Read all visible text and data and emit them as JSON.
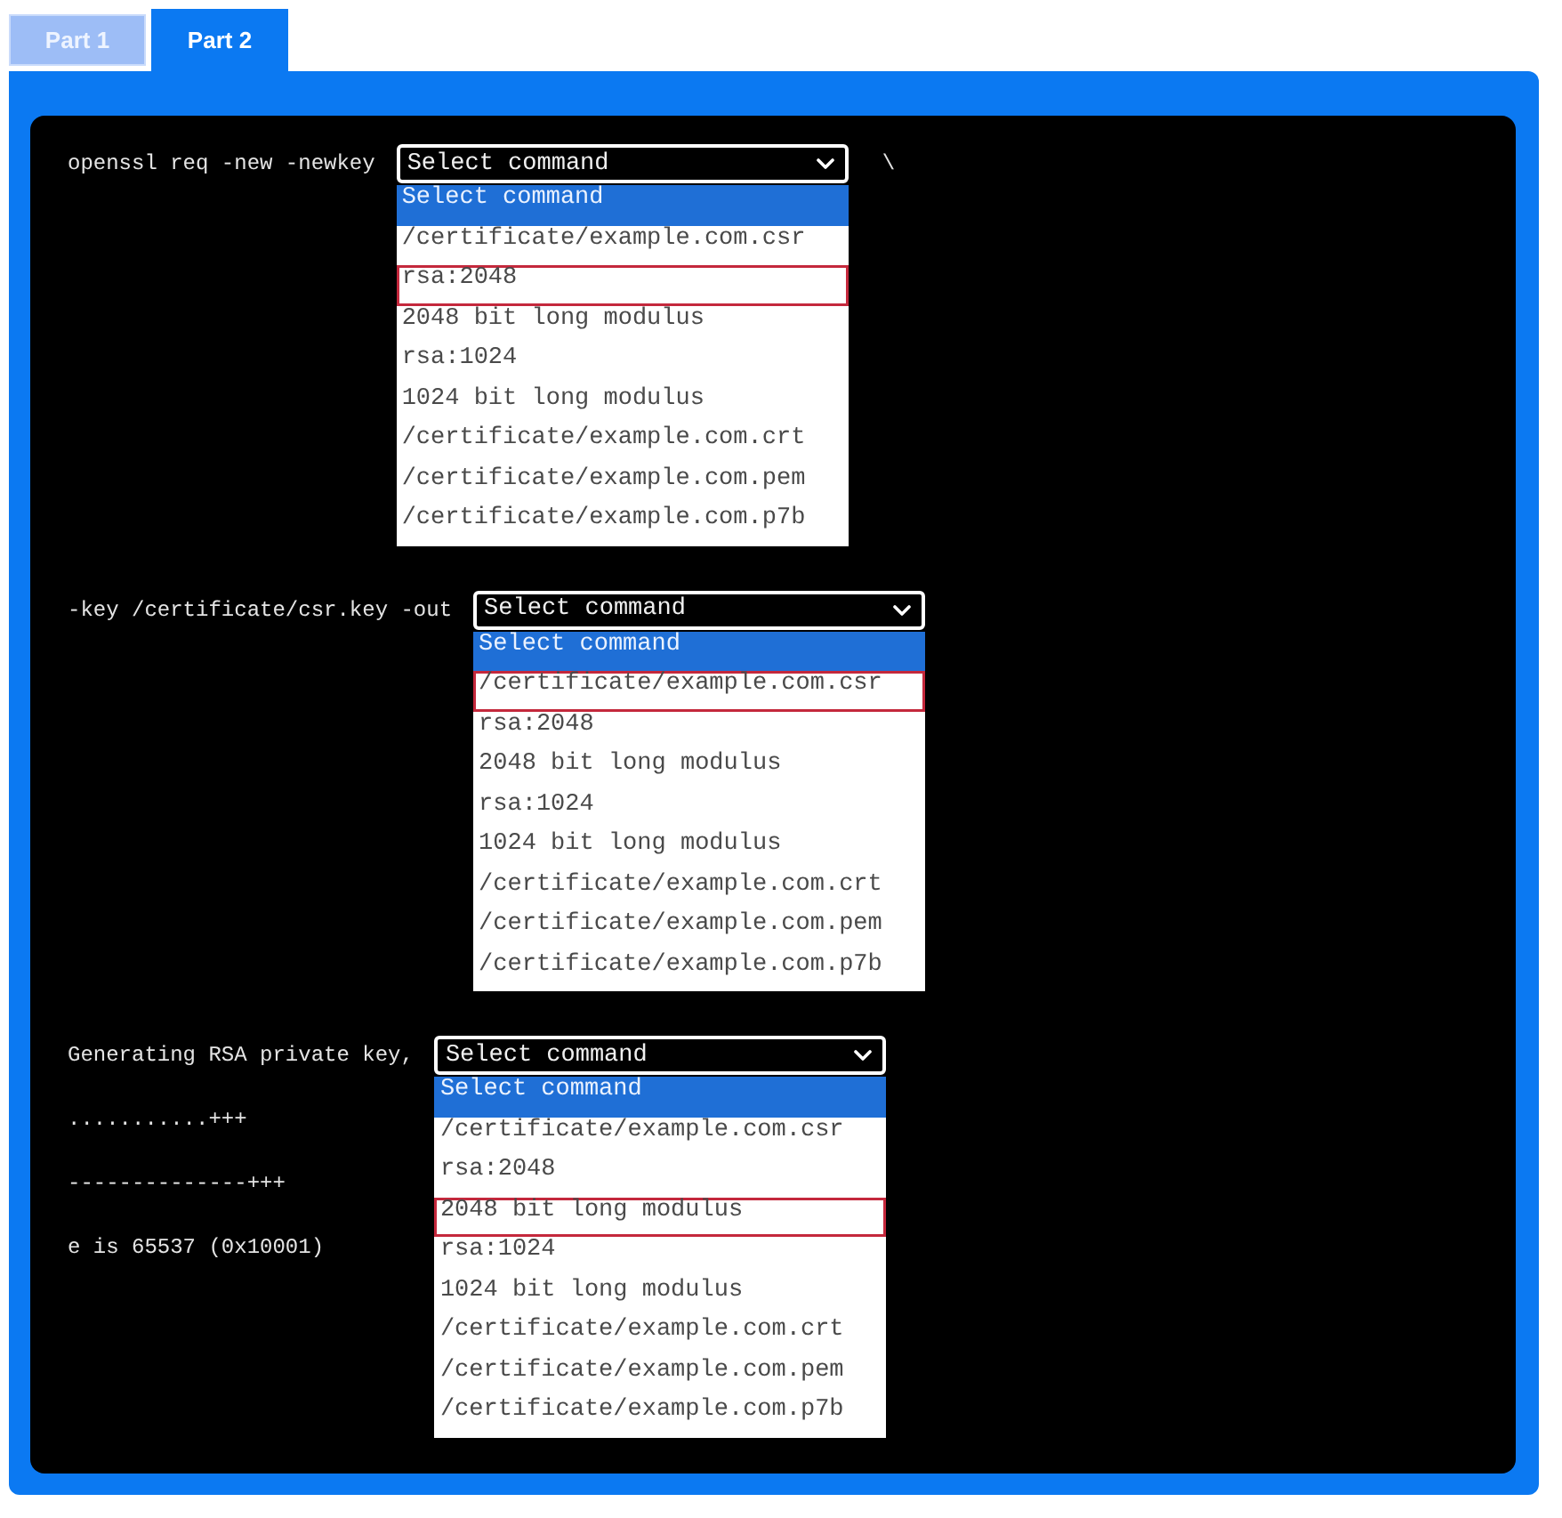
{
  "tabs": [
    {
      "label": "Part 1",
      "selected": false
    },
    {
      "label": "Part 2",
      "selected": true
    }
  ],
  "terminal": {
    "blocks": [
      {
        "lines": [
          "openssl req -new -newkey"
        ],
        "dropdown": {
          "value": "Select command",
          "expanded": true,
          "options": [
            {
              "label": "Select command",
              "selected": true,
              "marked": false
            },
            {
              "label": "/certificate/example.com.csr",
              "selected": false,
              "marked": false
            },
            {
              "label": "rsa:2048",
              "selected": false,
              "marked": true
            },
            {
              "label": "2048 bit long modulus",
              "selected": false,
              "marked": false
            },
            {
              "label": "rsa:1024",
              "selected": false,
              "marked": false
            },
            {
              "label": "1024 bit long modulus",
              "selected": false,
              "marked": false
            },
            {
              "label": "/certificate/example.com.crt",
              "selected": false,
              "marked": false
            },
            {
              "label": "/certificate/example.com.pem",
              "selected": false,
              "marked": false
            },
            {
              "label": "/certificate/example.com.p7b",
              "selected": false,
              "marked": false
            }
          ]
        },
        "trailing": "\\"
      },
      {
        "lines": [
          "-key /certificate/csr.key -out"
        ],
        "dropdown": {
          "value": "Select command",
          "expanded": true,
          "options": [
            {
              "label": "Select command",
              "selected": true,
              "marked": false
            },
            {
              "label": "/certificate/example.com.csr",
              "selected": false,
              "marked": true
            },
            {
              "label": "rsa:2048",
              "selected": false,
              "marked": false
            },
            {
              "label": "2048 bit long modulus",
              "selected": false,
              "marked": false
            },
            {
              "label": "rsa:1024",
              "selected": false,
              "marked": false
            },
            {
              "label": "1024 bit long modulus",
              "selected": false,
              "marked": false
            },
            {
              "label": "/certificate/example.com.crt",
              "selected": false,
              "marked": false
            },
            {
              "label": "/certificate/example.com.pem",
              "selected": false,
              "marked": false
            },
            {
              "label": "/certificate/example.com.p7b",
              "selected": false,
              "marked": false
            }
          ]
        }
      },
      {
        "lines": [
          "Generating RSA private key,",
          "...........+++",
          "--------------+++",
          "e is 65537 (0x10001)"
        ],
        "dropdown": {
          "value": "Select command",
          "expanded": true,
          "options": [
            {
              "label": "Select command",
              "selected": true,
              "marked": false
            },
            {
              "label": "/certificate/example.com.csr",
              "selected": false,
              "marked": false
            },
            {
              "label": "rsa:2048",
              "selected": false,
              "marked": false
            },
            {
              "label": "2048 bit long modulus",
              "selected": false,
              "marked": true
            },
            {
              "label": "rsa:1024",
              "selected": false,
              "marked": false
            },
            {
              "label": "1024 bit long modulus",
              "selected": false,
              "marked": false
            },
            {
              "label": "/certificate/example.com.crt",
              "selected": false,
              "marked": false
            },
            {
              "label": "/certificate/example.com.pem",
              "selected": false,
              "marked": false
            },
            {
              "label": "/certificate/example.com.p7b",
              "selected": false,
              "marked": false
            }
          ]
        }
      }
    ]
  }
}
